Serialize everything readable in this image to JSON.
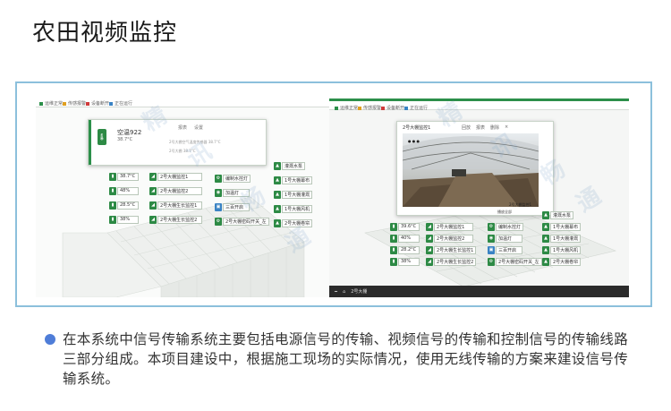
{
  "page": {
    "title": "农田视频监控",
    "description": "在本系统中信号传输系统主要包括电源信号的传输、视频信号的传输和控制信号的传输线路三部分组成。本项目建设中，根据施工现场的实际情况，使用无线传输的方案来建设信号传输系统。"
  },
  "watermark": {
    "text": "精讯畅通"
  },
  "legend": [
    {
      "label": "运维正常",
      "color": "#2c8f4a"
    },
    {
      "label": "传感报警",
      "color": "#e0a020"
    },
    {
      "label": "设备断开",
      "color": "#d03a3a"
    },
    {
      "label": "正在运行",
      "color": "#3a83c4"
    }
  ],
  "left_panel": {
    "popup": {
      "name": "空温922",
      "temp": "38.7°C",
      "tool_report": "报表",
      "tool_settings": "设置",
      "hint1": "2号大棚空气温度传感器 38.7°C",
      "hint2": "2号大棚 38.7°C"
    },
    "values": [
      "38.7°C",
      "48%",
      "28.5°C",
      "38%"
    ],
    "mid_labels": [
      "2号大棚监控1",
      "2号大棚监控2",
      "2号大棚生长监控1",
      "2号大棚生长监控2"
    ],
    "ctrl_labels": [
      "编制水控灯",
      "加温灯",
      "三百开启",
      "2号大棚密码开关_左"
    ],
    "right_labels": [
      "灌溉水泵",
      "1号大棚幕布",
      "1号大棚灌溉",
      "1号大棚风机",
      "2号大棚卷帘"
    ]
  },
  "right_panel": {
    "popup": {
      "title": "2号大棚监控1",
      "tool_backup": "回放",
      "tool_report": "报表",
      "tool_delete": "删除",
      "cam_label": "2号大棚监控1",
      "cam_button": "播放全部"
    },
    "values": [
      "39.6°C",
      "40%",
      "28.2°C",
      "38%"
    ],
    "mid_labels": [
      "2号大棚监控1",
      "2号大棚监控2",
      "2号大棚生长监控1",
      "2号大棚生长监控2"
    ],
    "ctrl_labels": [
      "编制水控灯",
      "加温灯",
      "三百开启",
      "2号大棚密码开关_左"
    ],
    "right_labels": [
      "灌溉水泵",
      "1号大棚幕布",
      "1号大棚灌溉",
      "1号大棚风机",
      "2号大棚卷帘"
    ],
    "bottom_label": "2号大棚"
  }
}
